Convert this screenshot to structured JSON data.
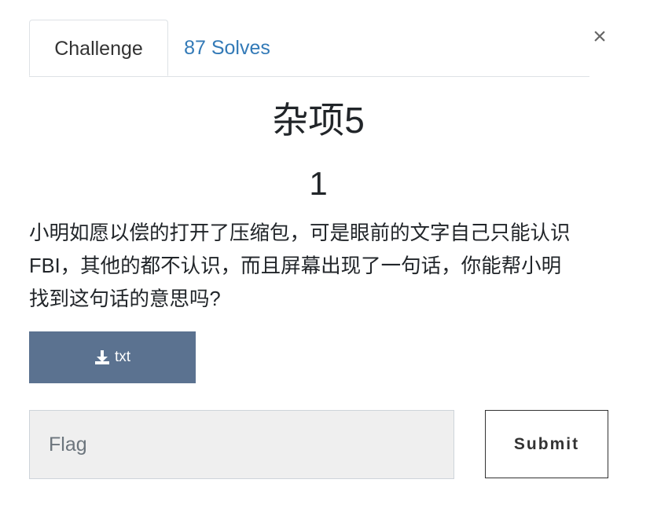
{
  "tabs": [
    {
      "label": "Challenge",
      "active": true
    },
    {
      "label": "87 Solves",
      "active": false
    }
  ],
  "close_glyph": "×",
  "challenge": {
    "name": "杂项5",
    "value": "1",
    "description": "小明如愿以偿的打开了压缩包，可是眼前的文字自己只能认识\nFBI，其他的都不认识，而且屏幕出现了一句话，你能帮小明\n找到这句话的意思吗?"
  },
  "download": {
    "label": "txt",
    "icon": "download-icon"
  },
  "flag_input": {
    "placeholder": "Flag",
    "value": ""
  },
  "submit_label": "Submit",
  "colors": {
    "tab_link": "#337ab7",
    "download_bg": "#5b7290",
    "input_bg": "#efefef"
  }
}
